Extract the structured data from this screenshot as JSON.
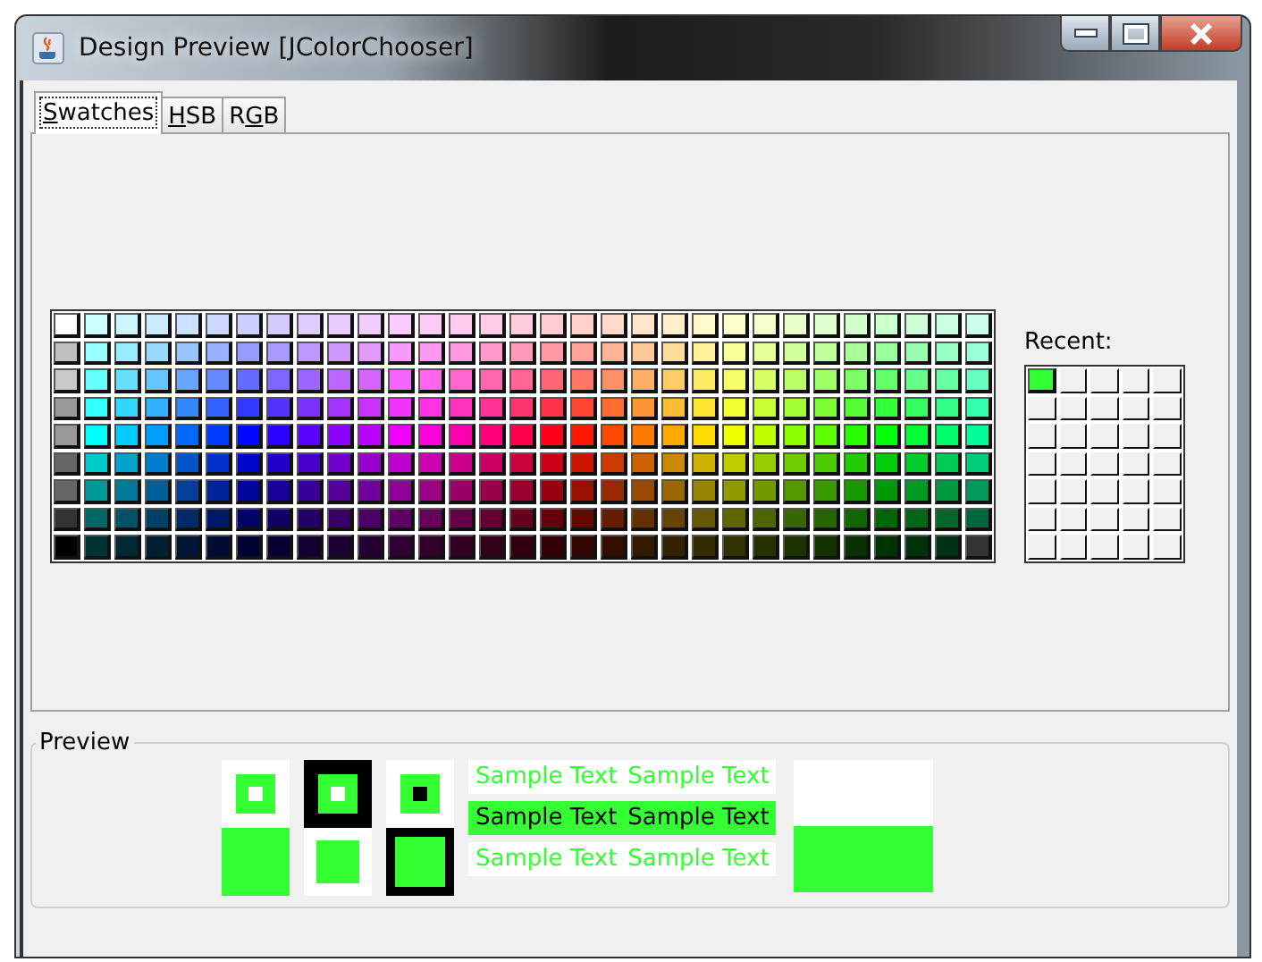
{
  "window": {
    "title": "Design Preview [JColorChooser]"
  },
  "tabs": [
    {
      "label": [
        {
          "text": "S",
          "underlined": true
        },
        {
          "text": "watches",
          "underlined": false
        }
      ],
      "selected": true
    },
    {
      "label": [
        {
          "text": "H",
          "underlined": true
        },
        {
          "text": "SB",
          "underlined": false
        }
      ],
      "selected": false
    },
    {
      "label": [
        {
          "text": "R",
          "underlined": false
        },
        {
          "text": "G",
          "underlined": true
        },
        {
          "text": "B",
          "underlined": false
        }
      ],
      "selected": false
    }
  ],
  "recent": {
    "label": "Recent:",
    "swatches": [
      {
        "color": "#33ff33"
      }
    ]
  },
  "preview": {
    "title": "Preview",
    "sample_texts": [
      "Sample Text",
      "Sample Text",
      "Sample Text",
      "Sample Text",
      "Sample Text",
      "Sample Text"
    ]
  }
}
